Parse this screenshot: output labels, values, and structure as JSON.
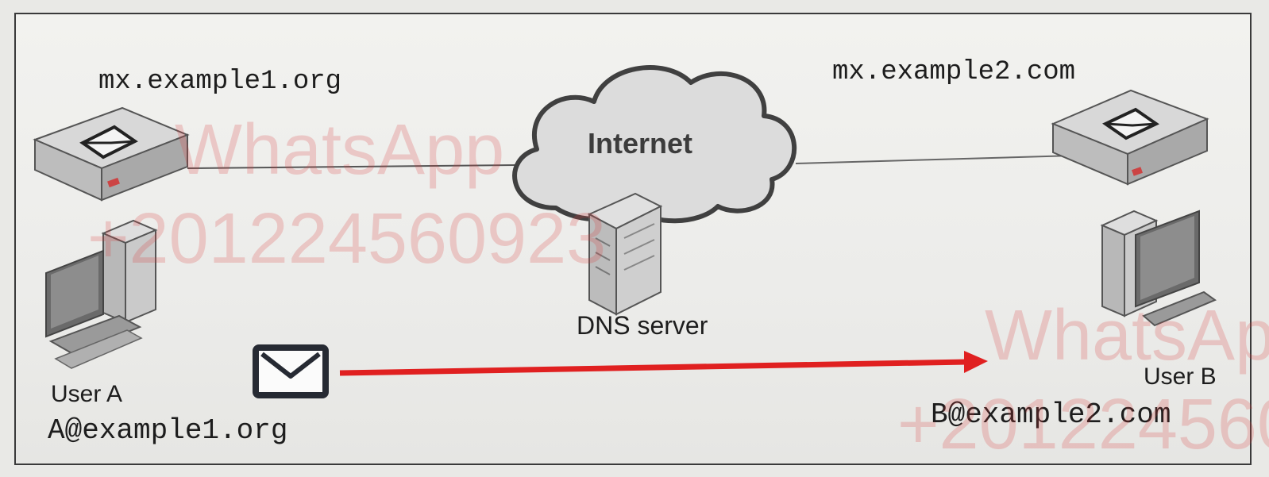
{
  "diagram": {
    "mail_server_a": {
      "hostname": "mx.example1.org"
    },
    "mail_server_b": {
      "hostname": "mx.example2.com"
    },
    "cloud": {
      "label": "Internet"
    },
    "dns": {
      "label": "DNS server"
    },
    "user_a": {
      "name": "User A",
      "address": "A@example1.org"
    },
    "user_b": {
      "name": "User B",
      "address": "B@example2.com"
    },
    "arrow": {
      "color": "#e02020",
      "direction": "user-a-to-user-b"
    }
  },
  "watermark": {
    "line1": "WhatsApp",
    "line2": "+201224560923",
    "color": "#dc3c3c"
  }
}
